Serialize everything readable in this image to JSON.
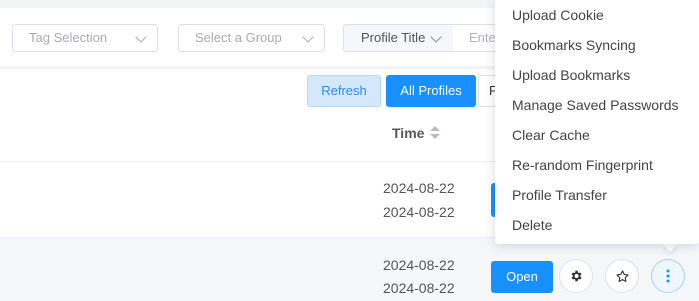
{
  "filters": {
    "tag_selection": "Tag Selection",
    "group_selection": "Select a Group",
    "search_field_label": "Profile Title",
    "search_placeholder": "Ente"
  },
  "toolbar": {
    "refresh_label": "Refresh",
    "all_profiles_label": "All Profiles",
    "partial_button_label": "F"
  },
  "table": {
    "time_header": "Time",
    "rows": [
      {
        "created": "2024-08-22",
        "updated": "2024-08-22"
      },
      {
        "created": "2024-08-22",
        "updated": "2024-08-22",
        "open_label": "Open"
      }
    ]
  },
  "more_menu": {
    "items": [
      "Upload Cookie",
      "Bookmarks Syncing",
      "Upload Bookmarks",
      "Manage Saved Passwords",
      "Clear Cache",
      "Re-random Fingerprint",
      "Profile Transfer",
      "Delete"
    ]
  },
  "colors": {
    "primary": "#1890ff",
    "refresh_bg": "#d3e8fb",
    "row_alt_bg": "#f5f7fa"
  },
  "icons": {
    "settings": "gear-icon",
    "favorite": "star-icon",
    "more": "more-vertical-icon"
  }
}
